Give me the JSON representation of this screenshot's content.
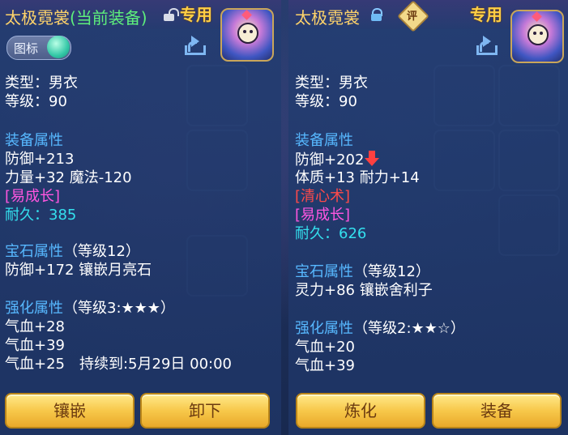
{
  "left": {
    "name": "太极霓裳",
    "tag": "(当前装备)",
    "badge": "专用",
    "icon_toggle_label": "图标",
    "type": "类型：男衣",
    "level": "等级：90",
    "attr_title": "装备属性",
    "attrs": [
      "防御+213",
      "力量+32 魔法-120"
    ],
    "growth": "[易成长]",
    "durability_label": "耐久：",
    "durability_value": "385",
    "gem_title": "宝石属性",
    "gem_level": "（等级12）",
    "gem_attr": "防御+172 镶嵌月亮石",
    "enhance_title": "强化属性",
    "enhance_level": "（等级3:★★★）",
    "enhance_attrs": [
      "气血+28",
      "气血+39",
      "气血+25　持续到:5月29日 00:00"
    ],
    "buttons": [
      "镶嵌",
      "卸下"
    ]
  },
  "right": {
    "name": "太极霓裳",
    "badge": "专用",
    "ping": "评",
    "type": "类型：男衣",
    "level": "等级：90",
    "attr_title": "装备属性",
    "attrs": [
      "防御+202",
      "体质+13 耐力+14"
    ],
    "special": "[清心术]",
    "growth": "[易成长]",
    "durability_label": "耐久：",
    "durability_value": "626",
    "gem_title": "宝石属性",
    "gem_level": "（等级12）",
    "gem_attr": "灵力+86 镶嵌舍利子",
    "enhance_title": "强化属性",
    "enhance_level": "（等级2:★★☆）",
    "enhance_attrs": [
      "气血+20",
      "气血+39"
    ],
    "buttons": [
      "炼化",
      "装备"
    ]
  },
  "colors": {
    "name": "#ffd46a",
    "current_tag": "#5ef07c",
    "section": "#57b8ff",
    "durability": "#34e0ee",
    "tag_magenta": "#ff56e0",
    "skill_red": "#ff4a4a",
    "button": "#f7c84a"
  }
}
